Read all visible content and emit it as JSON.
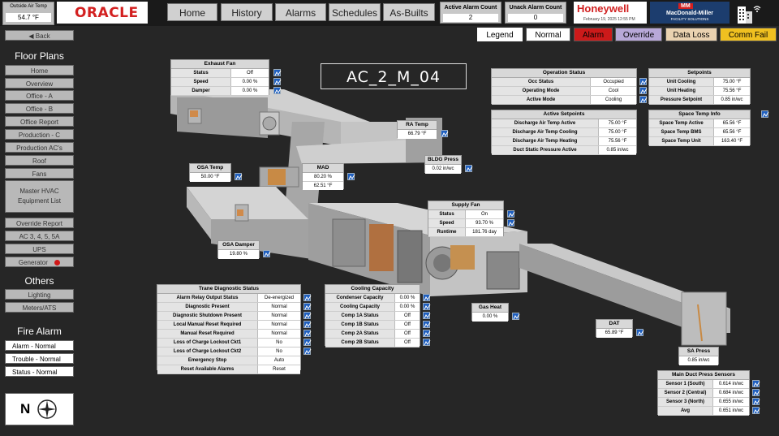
{
  "top": {
    "oat_label": "Outside Air Temp",
    "oat_value": "54.7 °F",
    "oracle": "ORACLE",
    "nav": [
      "Home",
      "History",
      "Alarms",
      "Schedules",
      "As-Builts"
    ],
    "active_alarm_label": "Active Alarm Count",
    "active_alarm_value": "2",
    "unack_alarm_label": "Unack Alarm Count",
    "unack_alarm_value": "0",
    "honeywell": "Honeywell",
    "date": "February 19, 2025 12:55 PM",
    "mm_logo": "MM",
    "mm_name": "MacDonald-Miller",
    "mm_sub": "FACILITY SOLUTIONS"
  },
  "legend": {
    "label": "Legend",
    "items": [
      {
        "label": "Normal",
        "color": "#ffffff"
      },
      {
        "label": "Alarm",
        "color": "#cc1a1a"
      },
      {
        "label": "Override",
        "color": "#b8a8d8"
      },
      {
        "label": "Data Loss",
        "color": "#ead2b0"
      },
      {
        "label": "Comm Fail",
        "color": "#f0c020"
      }
    ]
  },
  "sidebar": {
    "back": "Back",
    "floor_plans": "Floor Plans",
    "floor_items": [
      "Home",
      "Overview",
      "Office - A",
      "Office - B",
      "Office Report",
      "Production - C",
      "Production AC's",
      "Roof",
      "Fans"
    ],
    "master_hvac": "Master HVAC Equipment List",
    "more_items": [
      "Override Report",
      "AC 3, 4, 5, 5A",
      "UPS",
      "Generator"
    ],
    "others": "Others",
    "other_items": [
      "Lighting",
      "Meters/ATS"
    ],
    "fire_alarm": "Fire Alarm",
    "fire_items": [
      "Alarm - Normal",
      "Trouble - Normal",
      "Status - Normal"
    ],
    "compass_letter": "N"
  },
  "unit_title": "AC_2_M_04",
  "exhaust_fan": {
    "title": "Exhaust Fan",
    "rows": [
      {
        "label": "Status",
        "value": "Off"
      },
      {
        "label": "Speed",
        "value": "0.00 %"
      },
      {
        "label": "Damper",
        "value": "0.00 %"
      }
    ]
  },
  "operation_status": {
    "title": "Operation Status",
    "rows": [
      {
        "label": "Occ Status",
        "value": "Occupied"
      },
      {
        "label": "Operating Mode",
        "value": "Cool"
      },
      {
        "label": "Active Mode",
        "value": "Cooling"
      }
    ]
  },
  "setpoints": {
    "title": "Setpoints",
    "rows": [
      {
        "label": "Unit Cooling",
        "value": "75.00 °F"
      },
      {
        "label": "Unit Heating",
        "value": "75.56 °F"
      },
      {
        "label": "Pressure Setpoint",
        "value": "0.85 in/wc"
      }
    ]
  },
  "active_setpoints": {
    "title": "Active Setpoints",
    "rows": [
      {
        "label": "Discharge Air Temp Active",
        "value": "75.00 °F"
      },
      {
        "label": "Discharge Air Temp Cooling",
        "value": "75.00 °F"
      },
      {
        "label": "Discharge Air Temp Heating",
        "value": "75.56 °F"
      },
      {
        "label": "Duct Static Pressure Active",
        "value": "0.85 in/wc"
      }
    ]
  },
  "space_temp": {
    "title": "Space Temp Info",
    "rows": [
      {
        "label": "Space Temp Active",
        "value": "65.56 °F"
      },
      {
        "label": "Space Temp BMS",
        "value": "65.56 °F"
      },
      {
        "label": "Space Temp Unit",
        "value": "163.40 °F"
      }
    ]
  },
  "ra_temp": {
    "title": "RA Temp",
    "value": "66.79 °F"
  },
  "bldg_press": {
    "title": "BLDG Press",
    "value": "0.02 in/wc"
  },
  "osa_temp": {
    "title": "OSA Temp",
    "value": "50.00 °F"
  },
  "mad": {
    "title": "MAD",
    "value1": "80.20 %",
    "value2": "62.51 °F"
  },
  "supply_fan": {
    "title": "Supply Fan",
    "rows": [
      {
        "label": "Status",
        "value": "On"
      },
      {
        "label": "Speed",
        "value": "93.70 %"
      },
      {
        "label": "Runtime",
        "value": "181.76 day"
      }
    ]
  },
  "osa_damper": {
    "title": "OSA Damper",
    "value": "19.80 %"
  },
  "gas_heat": {
    "title": "Gas Heat",
    "value": "0.00 %"
  },
  "dat": {
    "title": "DAT",
    "value": "65.89 °F"
  },
  "sa_press": {
    "title": "SA Press",
    "value": "0.85 in/wc"
  },
  "trane": {
    "title": "Trane Diagnostic Status",
    "rows": [
      {
        "label": "Alarm Relay Output Status",
        "value": "De-energized"
      },
      {
        "label": "Diagnostic Present",
        "value": "Normal"
      },
      {
        "label": "Diagnostic Shutdown Present",
        "value": "Normal"
      },
      {
        "label": "Local Manual Reset Required",
        "value": "Normal"
      },
      {
        "label": "Manual Reset Required",
        "value": "Normal"
      },
      {
        "label": "Loss of Charge Lockout Ckt1",
        "value": "No"
      },
      {
        "label": "Loss of Charge Lockout Ckt2",
        "value": "No"
      },
      {
        "label": "Emergency Stop",
        "value": "Auto"
      },
      {
        "label": "Reset Available Alarms",
        "value": "Reset"
      }
    ]
  },
  "cooling": {
    "title": "Cooling Capacity",
    "rows": [
      {
        "label": "Condenser Capacity",
        "value": "0.00 %"
      },
      {
        "label": "Cooling Capacity",
        "value": "0.00 %"
      },
      {
        "label": "Comp 1A Status",
        "value": "Off"
      },
      {
        "label": "Comp 1B Status",
        "value": "Off"
      },
      {
        "label": "Comp 2A Status",
        "value": "Off"
      },
      {
        "label": "Comp 2B Status",
        "value": "Off"
      }
    ]
  },
  "duct_press": {
    "title": "Main Duct Press Sensors",
    "rows": [
      {
        "label": "Sensor 1 (South)",
        "value": "0.614 in/wc"
      },
      {
        "label": "Sensor 2 (Central)",
        "value": "0.684 in/wc"
      },
      {
        "label": "Sensor 3 (North)",
        "value": "0.655 in/wc"
      },
      {
        "label": "Avg",
        "value": "0.651 in/wc"
      }
    ]
  }
}
